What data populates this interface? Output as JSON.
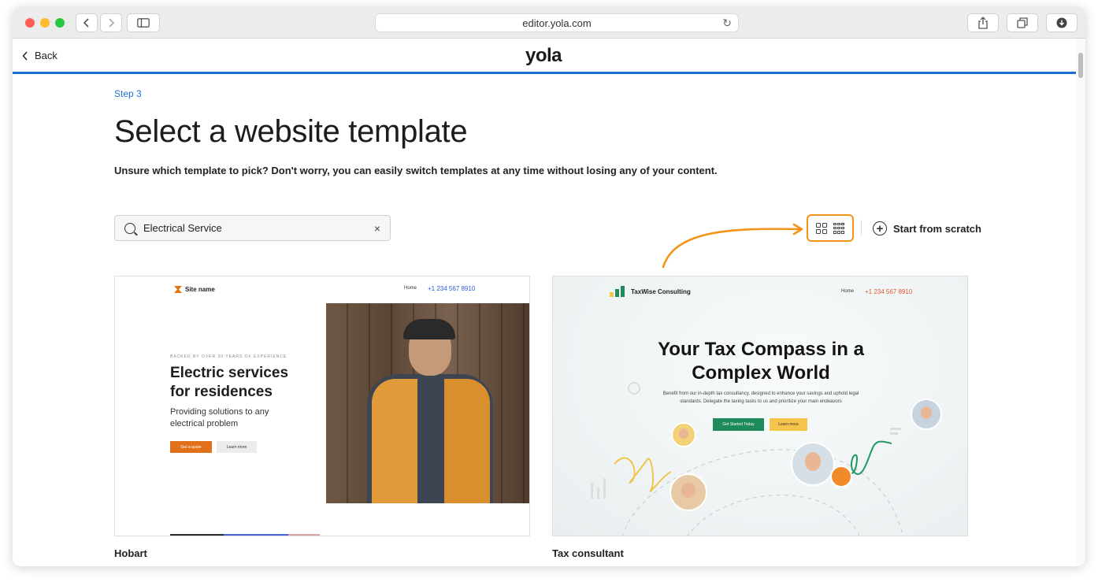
{
  "browser": {
    "url": "editor.yola.com"
  },
  "appbar": {
    "back_label": "Back",
    "logo_text": "yola"
  },
  "page": {
    "step": "Step 3",
    "title": "Select a website template",
    "subtitle": "Unsure which template to pick? Don't worry, you can easily switch templates at any time without losing any of your content."
  },
  "search": {
    "value": "Electrical Service",
    "clear_glyph": "×"
  },
  "toolbar": {
    "start_from_scratch": "Start from scratch",
    "highlight_color": "#f39416"
  },
  "templates": [
    {
      "name": "Hobart",
      "preview": {
        "site_name": "Site name",
        "nav_home": "Home",
        "phone": "+1 234 567 8910",
        "kicker": "BACKED BY OVER 30 YEARS OF EXPERIENCE",
        "headline": "Electric services for residences",
        "description": "Providing solutions to any electrical problem",
        "cta_primary": "Get a quote",
        "cta_secondary": "Learn more"
      }
    },
    {
      "name": "Tax consultant",
      "preview": {
        "site_name": "TaxWise Consulting",
        "nav_home": "Home",
        "phone": "+1 234 567 8910",
        "headline": "Your Tax Compass in a Complex World",
        "description": "Benefit from our in-depth tax consultancy, designed to enhance your savings and uphold legal standards. Delegate the taxing tasks to us and prioritize your main endeavors",
        "cta_primary": "Get Started Today",
        "cta_secondary": "Learn more"
      }
    }
  ]
}
